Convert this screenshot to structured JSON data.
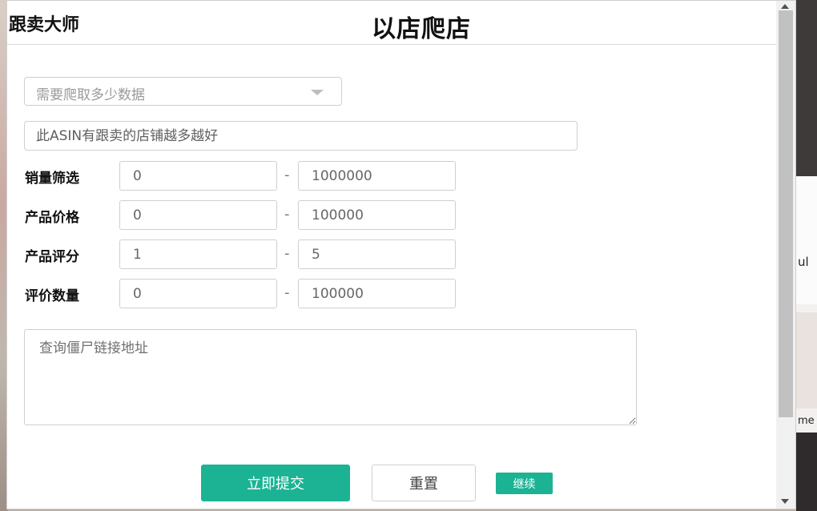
{
  "header": {
    "brand": "跟卖大师",
    "title": "以店爬店"
  },
  "form": {
    "quantity_select": {
      "selected": "需要爬取多少数据"
    },
    "asin_input": {
      "placeholder": "此ASIN有跟卖的店铺越多越好"
    },
    "filters": [
      {
        "label": "销量筛选",
        "min": "0",
        "max": "1000000"
      },
      {
        "label": "产品价格",
        "min": "0",
        "max": "100000"
      },
      {
        "label": "产品评分",
        "min": "1",
        "max": "5"
      },
      {
        "label": "评价数量",
        "min": "0",
        "max": "100000"
      }
    ],
    "range_separator": "-",
    "zombie_links": {
      "placeholder": "查询僵尸链接地址"
    }
  },
  "buttons": {
    "submit": "立即提交",
    "reset": "重置",
    "continue": "继续"
  },
  "background_page": {
    "peek_text_1": "ul",
    "peek_text_2": "me"
  },
  "colors": {
    "accent": "#1bb394",
    "border": "#cfcfcf"
  }
}
